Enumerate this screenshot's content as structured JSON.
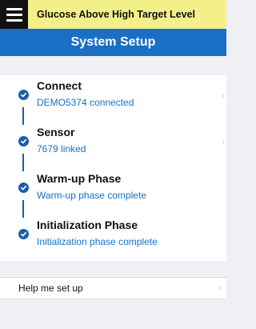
{
  "alert": {
    "text": "Glucose Above High Target Level",
    "menu_icon": "hamburger-menu-icon"
  },
  "header": {
    "title": "System Setup"
  },
  "steps": [
    {
      "title": "Connect",
      "status": "DEMO5374 connected",
      "has_chevron": true
    },
    {
      "title": "Sensor",
      "status": "7679 linked",
      "has_chevron": true
    },
    {
      "title": "Warm-up Phase",
      "status": "Warm-up phase complete",
      "has_chevron": false
    },
    {
      "title": "Initialization Phase",
      "status": "Initialization phase complete",
      "has_chevron": false
    }
  ],
  "help": {
    "label": "Help me set up"
  },
  "colors": {
    "alert_bg": "#f3f08a",
    "header_bg": "#1a6fc4",
    "status_text": "#1a6fc4",
    "check": "#1a5fa8",
    "page_bg": "#efeff4"
  }
}
